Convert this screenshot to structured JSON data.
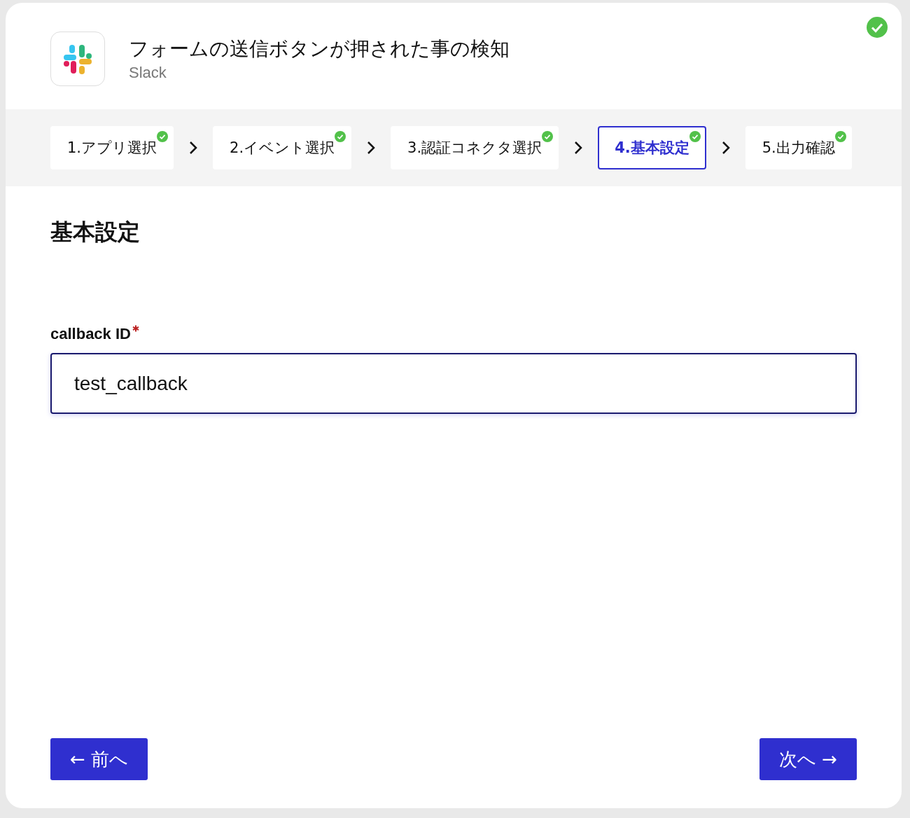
{
  "header": {
    "title": "フォームの送信ボタンが押された事の検知",
    "app_name": "Slack",
    "completed": true
  },
  "steps": [
    {
      "label": "1.アプリ選択",
      "done": true,
      "selected": false
    },
    {
      "label": "2.イベント選択",
      "done": true,
      "selected": false
    },
    {
      "label": "3.認証コネクタ選択",
      "done": true,
      "selected": false
    },
    {
      "label": "4.基本設定",
      "done": true,
      "selected": true
    },
    {
      "label": "5.出力確認",
      "done": true,
      "selected": false
    }
  ],
  "section_title": "基本設定",
  "field": {
    "label": "callback ID",
    "required": true,
    "value": "test_callback"
  },
  "buttons": {
    "back": "← 前へ",
    "next": "次へ →"
  }
}
